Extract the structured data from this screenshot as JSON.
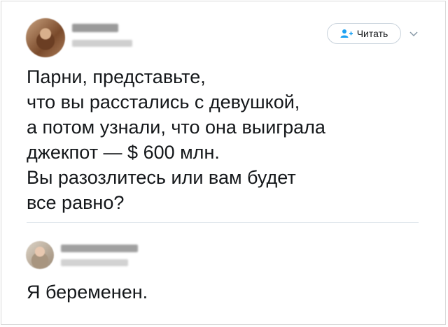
{
  "tweet": {
    "follow_label": "Читать",
    "text": "Парни, представьте,\nчто вы расстались с девушкой,\nа потом узнали, что она выиграла\nджекпот — $ 600 млн.\nВы разозлитесь или вам будет\nвсе равно?"
  },
  "reply": {
    "text": "Я беременен."
  },
  "icons": {
    "follow": "add-user-icon",
    "menu": "chevron-down-icon"
  },
  "colors": {
    "accent": "#1da1f2",
    "text": "#14171a",
    "border": "#c9d3dc"
  }
}
